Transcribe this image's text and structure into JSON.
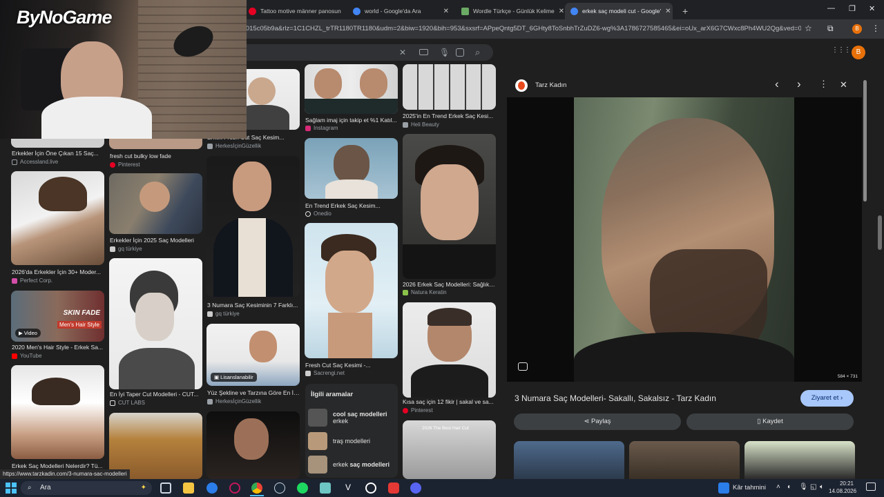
{
  "tabs": [
    {
      "title": "Tattoo motive männer panosun",
      "close": "✕",
      "color": "#e60023"
    },
    {
      "title": "world - Google'da Ara",
      "close": "✕",
      "color": "#4285f4"
    },
    {
      "title": "Wordle Türkçe - Günlük Kelime",
      "close": "✕",
      "color": "#6aaa64"
    },
    {
      "title": "erkek saç modeli cut - Google'",
      "close": "✕",
      "color": "#4285f4"
    }
  ],
  "new_tab": "+",
  "window_controls": {
    "minimize": "—",
    "restore": "❐",
    "close": "✕"
  },
  "address": {
    "url": "f8f8015c05b9a&rlz=1C1CHZL_trTR1180TR1180&udm=2&biw=1920&bih=953&sxsrf=APpeQntg5DT_6GHty8ToSnbhTrZuDZ6-wg%3A1786727585465&ei=oUx_arX6G7CWxc8Ph4WU2Qg&ved=0...",
    "profile_letter": "B"
  },
  "search": {
    "clear": "✕"
  },
  "account": {
    "avatar_letter": "B",
    "apps": "⋮⋮⋮"
  },
  "overlay": {
    "brand": "ByNoGame"
  },
  "results": {
    "col1": [
      {
        "caption": "Erkekler İçin Öne Çıkan 15 Saç...",
        "source": "Accessland.live",
        "color": "#8e8e8e"
      },
      {
        "caption": "2026'da Erkekler İçin 30+ Moder...",
        "source": "Perfect Corp.",
        "color": "#d44da8"
      },
      {
        "caption": "2020 Men's Hair Style - Erkek Sa...",
        "source": "YouTube",
        "color": "#ff0000",
        "badge": "Video",
        "overlay_title": "SKIN FADE",
        "overlay_sub": "Men's Hair Style"
      },
      {
        "caption": "Erkek Saç Modelleri Nelerdir? Tü...",
        "source": "",
        "color": "#888888"
      }
    ],
    "col2": [
      {
        "caption": "fresh cut bulky low fade",
        "source": "Pinterest",
        "color": "#e60023"
      },
      {
        "caption": "Erkekler İçin 2025 Saç Modelleri",
        "source": "gq türkiye",
        "color": "#cccccc"
      },
      {
        "caption": "En İyi Taper Cut Modelleri - CUT...",
        "source": "CUT LABS",
        "color": "#cccccc"
      }
    ],
    "col3": [
      {
        "caption": "Erkek Fresh Cut Saç Kesim...",
        "source": "HerkesİçinGüzellik",
        "color": "#9aa0a6"
      },
      {
        "caption": "3 Numara Saç Kesiminin 7 Farklı...",
        "source": "gq türkiye",
        "color": "#cccccc"
      },
      {
        "caption": "Yüz Şekline ve Tarzına Göre En İy...",
        "source": "HerkesİçinGüzellik",
        "color": "#9aa0a6",
        "badge": "Lisanslanabilir"
      }
    ],
    "col4": [
      {
        "caption": "Sağlam imaj için takip et %1 Katıl...",
        "source": "Instagram",
        "color": "#d62976"
      },
      {
        "caption": "En Trend Erkek Saç Kesim...",
        "source": "Onedio",
        "color": "#e3e3e3"
      },
      {
        "caption": "Fresh Cut Saç Kesimi -...",
        "source": "Sacrengi.net",
        "color": "#cccccc"
      }
    ],
    "col5": [
      {
        "caption": "2025'in En Trend Erkek Saç Kesi...",
        "source": "Heli Beauty",
        "color": "#9aa0a6"
      },
      {
        "caption": "2026 Erkek Saç Modelleri: Sağlıkl...",
        "source": "Natura Keratin",
        "color": "#8bc34a"
      },
      {
        "caption": "Kısa saç için 12 fikir | sakal ve sa...",
        "source": "Pinterest",
        "color": "#e60023"
      },
      {
        "caption": "",
        "source": "",
        "color": "#888888",
        "overlay_title": "2026 The Best Hair Cut"
      }
    ]
  },
  "related": {
    "heading": "İlgili aramalar",
    "items": [
      {
        "bold": "cool saç modelleri",
        "normal": "erkek"
      },
      {
        "bold": "",
        "normal": "traş modelleri"
      },
      {
        "bold": "saç modelleri",
        "normal": "erkek"
      }
    ]
  },
  "panel": {
    "site": "Tarz Kadın",
    "prev": "‹",
    "next": "›",
    "more": "⋮",
    "close": "✕",
    "dimensions": "584 × 731",
    "title": "3 Numara Saç Modelleri- Sakallı, Sakalsız - Tarz Kadın",
    "visit": "Ziyaret et",
    "share": "Paylaş",
    "save": "Kaydet"
  },
  "status_url": "https://www.tarzkadin.com/3-numara-sac-modelleri",
  "taskbar": {
    "search_placeholder": "Ara",
    "weather": "Kâr tahmini",
    "time": "20:21",
    "date": "14.08.2026"
  }
}
